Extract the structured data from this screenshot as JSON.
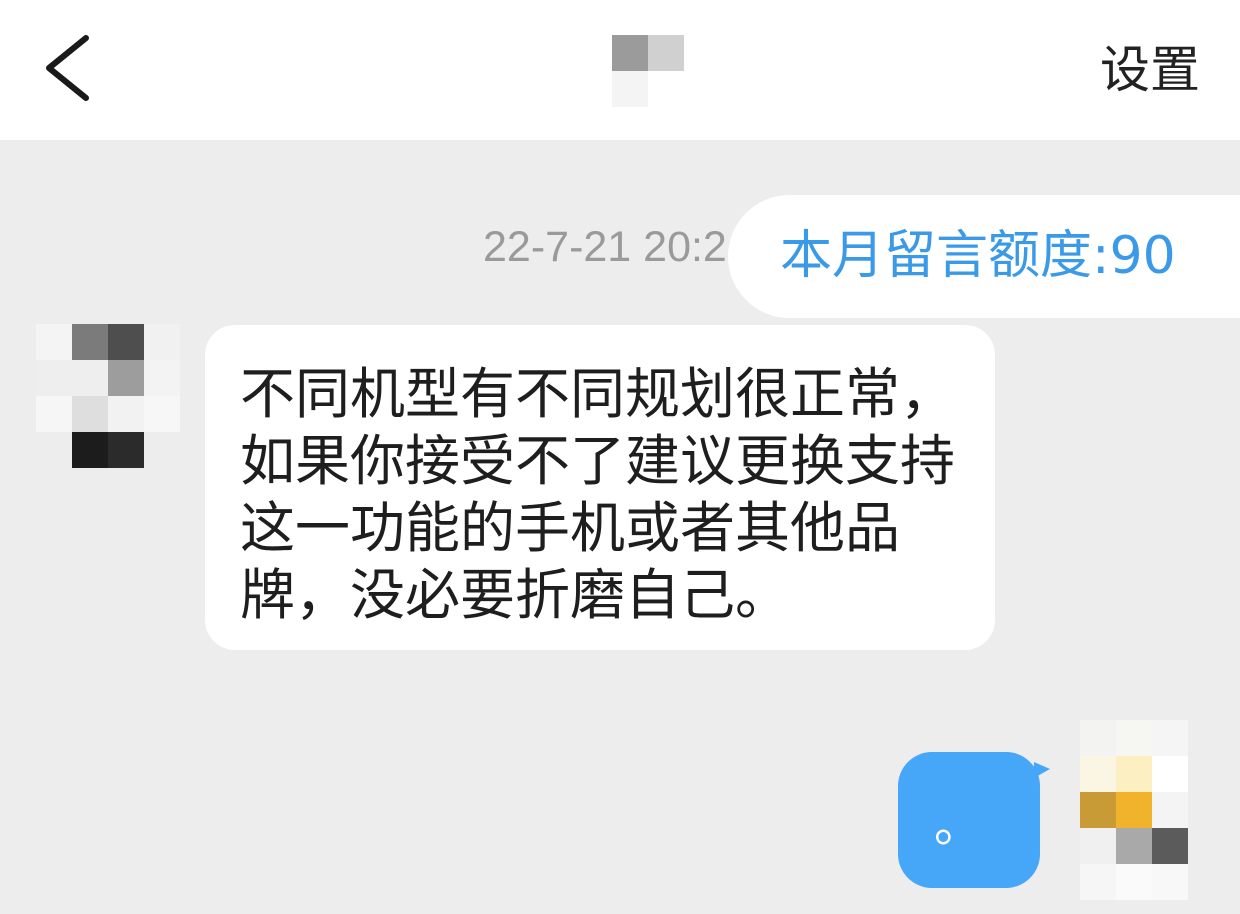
{
  "header": {
    "back_icon": "chevron-left-icon",
    "title_redacted_mosaic": [
      [
        "#9b9b9b",
        "#d0d0d0"
      ],
      [
        "#f4f4f4",
        "#ffffff"
      ]
    ],
    "settings_label": "设置"
  },
  "chat": {
    "timestamp": "22-7-21 20:2",
    "quota_notice": "本月留言额度:90",
    "incoming_message": {
      "avatar_mosaic": [
        [
          "#f4f4f4",
          "#7b7b7b",
          "#4e4e4e",
          "#f1f1f1"
        ],
        [
          "#eeeeee",
          "#eeeeee",
          "#9d9d9d",
          "#f3f3f3"
        ],
        [
          "#f6f6f6",
          "#dedede",
          "#f2f2f2",
          "#f7f7f7"
        ],
        [
          "#ededed",
          "#1c1c1c",
          "#2b2b2b",
          "#ededed"
        ]
      ],
      "lines": [
        "不同机型有不同规划很正常，",
        "如果你接受不了建议更换支持",
        "这一功能的手机或者其他品",
        "牌，没必要折磨自己。"
      ]
    },
    "outgoing_message": {
      "avatar_mosaic": [
        [
          "#f3f3f1",
          "#f6f6f3",
          "#f5f5f5"
        ],
        [
          "#faf6e3",
          "#fcefc2",
          "#ffffff"
        ],
        [
          "#c99b36",
          "#f1b32b",
          "#f4f4f4"
        ],
        [
          "#f0f0f0",
          "#a9a9a9",
          "#5b5b5b"
        ],
        [
          "#f6f6f6",
          "#fafafa",
          "#f8f8f8"
        ]
      ],
      "text": "。"
    }
  },
  "colors": {
    "page_background": "#ededed",
    "header_background": "#ffffff",
    "incoming_bubble": "#ffffff",
    "outgoing_bubble": "#46a6f8",
    "quota_text": "#3a9ae8",
    "timestamp_text": "#9a9a9a",
    "message_text": "#1e1e1e"
  }
}
